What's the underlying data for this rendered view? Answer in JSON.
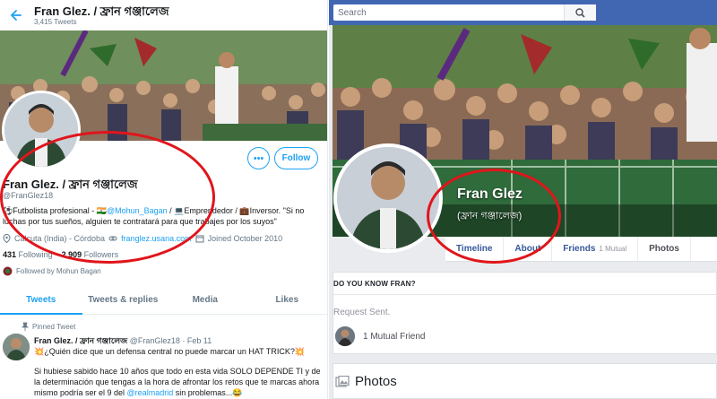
{
  "twitter": {
    "header": {
      "name": "Fran Glez. / ফ্রান গঞ্জালেজ",
      "tweet_count": "3,415 Tweets"
    },
    "actions": {
      "more_label": "•••",
      "follow_label": "Follow"
    },
    "profile": {
      "name": "Fran Glez. / ফ্রান গঞ্জালেজ",
      "handle": "@FranGlez18",
      "bio_part1": "⚽Futbolista profesional - 🇮🇳",
      "bio_mention": "@Mohun_Bagan",
      "bio_part2": " / 💻Emprendedor / 💼Inversor. \"Si no luchas por tus sueños, alguien te contratará para que trabajes por los suyos\"",
      "location": "Calcuta (India) - Córdoba",
      "website": "franglez.usana.com",
      "joined": "Joined October 2010",
      "following_count": "431",
      "following_label": "Following",
      "followers_count": "2,909",
      "followers_label": "Followers",
      "followed_by": "Followed by Mohun Bagan"
    },
    "tabs": [
      "Tweets",
      "Tweets & replies",
      "Media",
      "Likes"
    ],
    "pinned_label": "Pinned Tweet",
    "tweet": {
      "name": "Fran Glez. / ফ্রান গঞ্জালেজ",
      "handle": "@FranGlez18",
      "date": "· Feb 11",
      "line1": "💥¿Quién dice que un defensa central no puede marcar un HAT TRICK?💥",
      "body_part1": "Si hubiese sabido hace 10 años que todo en esta vida SOLO DEPENDE TI y de la determinación que tengas a la hora de afrontar los retos que te marcas ahora mismo podría ser el 9 del ",
      "body_mention": "@realmadrid",
      "body_part2": " sin problemas...😂"
    }
  },
  "facebook": {
    "search_placeholder": "Search",
    "name": "Fran Glez",
    "name_bengali": "(ফ্রান গঞ্জালেজ)",
    "tabs": [
      {
        "label": "Timeline",
        "extra": ""
      },
      {
        "label": "About",
        "extra": ""
      },
      {
        "label": "Friends",
        "extra": "1 Mutual"
      },
      {
        "label": "Photos",
        "extra": ""
      }
    ],
    "know_title": "DO YOU KNOW FRAN?",
    "request_status": "Request Sent.",
    "mutual_friends": "1 Mutual Friend",
    "photos_heading": "Photos"
  },
  "colors": {
    "twitter_blue": "#1da1f2",
    "facebook_blue": "#4267b2",
    "annotation_red": "#e0151b"
  }
}
